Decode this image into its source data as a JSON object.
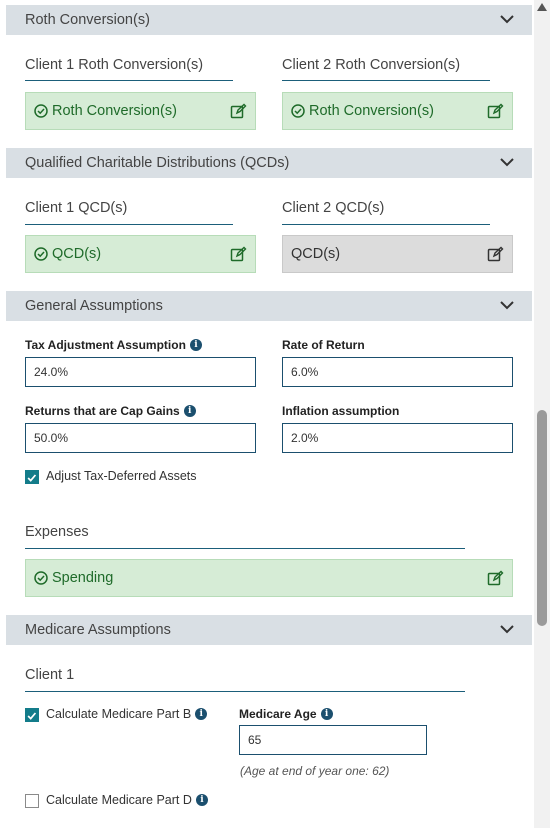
{
  "sections": {
    "roth": {
      "title": "Roth Conversion(s)",
      "client1_title": "Client 1 Roth Conversion(s)",
      "client2_title": "Client 2 Roth Conversion(s)",
      "client1_card": "Roth Conversion(s)",
      "client2_card": "Roth Conversion(s)"
    },
    "qcd": {
      "title": "Qualified Charitable Distributions (QCDs)",
      "client1_title": "Client 1 QCD(s)",
      "client2_title": "Client 2 QCD(s)",
      "client1_card": "QCD(s)",
      "client2_card": "QCD(s)"
    },
    "general": {
      "title": "General Assumptions",
      "tax_adjustment_label": "Tax Adjustment Assumption",
      "tax_adjustment_value": "24.0%",
      "rate_of_return_label": "Rate of Return",
      "rate_of_return_value": "6.0%",
      "cap_gains_label": "Returns that are Cap Gains",
      "cap_gains_value": "50.0%",
      "inflation_label": "Inflation assumption",
      "inflation_value": "2.0%",
      "adjust_tax_deferred_label": "Adjust Tax-Deferred Assets",
      "adjust_tax_deferred_checked": true,
      "expenses_title": "Expenses",
      "spending_card": "Spending"
    },
    "medicare": {
      "title": "Medicare Assumptions",
      "client1_title": "Client 1",
      "part_b_label": "Calculate Medicare Part B",
      "part_b_checked": true,
      "medicare_age_label": "Medicare Age",
      "medicare_age_value": "65",
      "age_hint": "(Age at end of year one: 62)",
      "part_d_label": "Calculate Medicare Part D",
      "part_d_checked": false
    }
  },
  "colors": {
    "accent": "#1b4f6e",
    "checkbox": "#137c8a",
    "card_green": "#d6ecd6",
    "card_grey": "#dcdcdc",
    "header_bg": "#d9dfe4"
  }
}
